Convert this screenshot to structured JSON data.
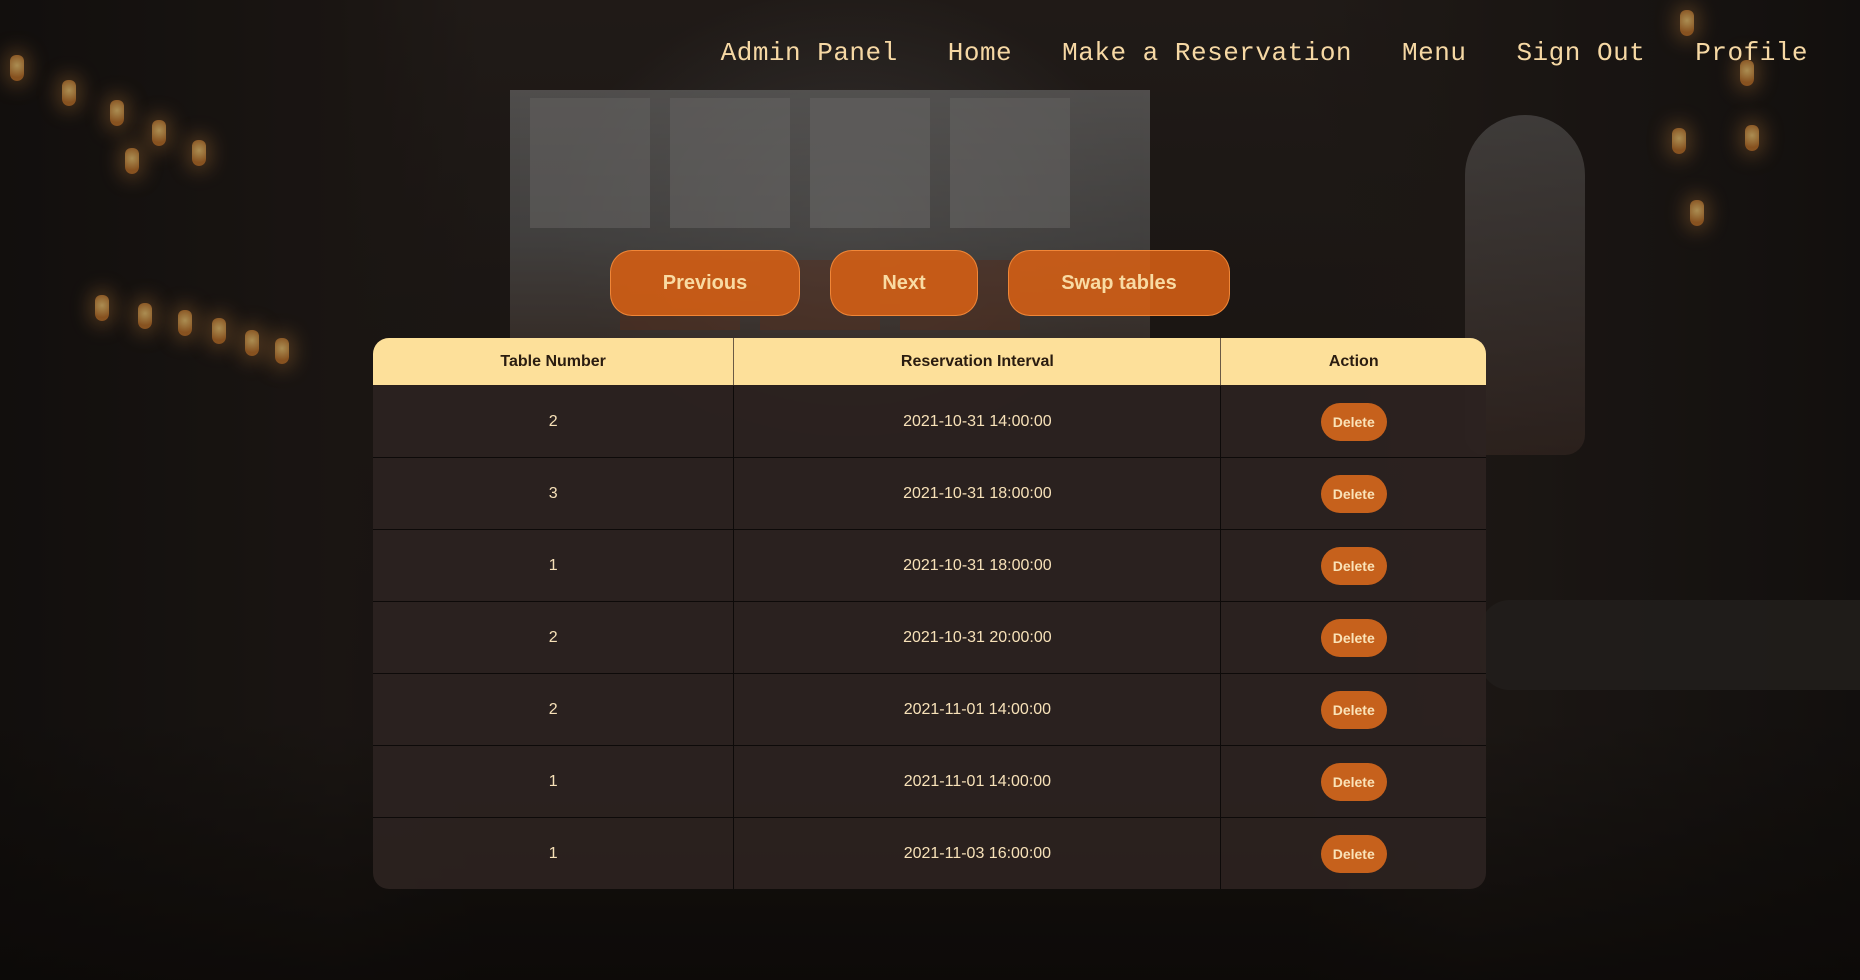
{
  "nav": {
    "items": [
      {
        "label": "Admin Panel"
      },
      {
        "label": "Home"
      },
      {
        "label": "Make a Reservation"
      },
      {
        "label": "Menu"
      },
      {
        "label": "Sign Out"
      },
      {
        "label": "Profile"
      }
    ]
  },
  "buttons": {
    "previous": "Previous",
    "next": "Next",
    "swap": "Swap tables"
  },
  "table": {
    "headers": [
      "Table Number",
      "Reservation Interval",
      "Action"
    ],
    "rows": [
      {
        "table_number": "2",
        "interval": "2021-10-31 14:00:00",
        "action": "Delete"
      },
      {
        "table_number": "3",
        "interval": "2021-10-31 18:00:00",
        "action": "Delete"
      },
      {
        "table_number": "1",
        "interval": "2021-10-31 18:00:00",
        "action": "Delete"
      },
      {
        "table_number": "2",
        "interval": "2021-10-31 20:00:00",
        "action": "Delete"
      },
      {
        "table_number": "2",
        "interval": "2021-11-01 14:00:00",
        "action": "Delete"
      },
      {
        "table_number": "1",
        "interval": "2021-11-01 14:00:00",
        "action": "Delete"
      },
      {
        "table_number": "1",
        "interval": "2021-11-03 16:00:00",
        "action": "Delete"
      }
    ]
  },
  "colors": {
    "accent": "#d66014",
    "header_bg": "#fde09a",
    "text_light": "#f6d8a4"
  }
}
